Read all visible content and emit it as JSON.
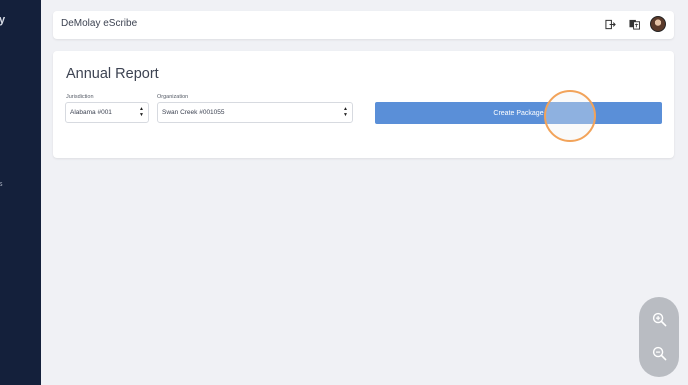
{
  "sidebar": {
    "top_glyph": "y",
    "mid_glyph": "s"
  },
  "header": {
    "app_title": "DeMolay eScribe",
    "icons": [
      "logout-icon",
      "translate-icon",
      "user-avatar"
    ]
  },
  "page": {
    "title": "Annual Report",
    "jurisdiction": {
      "label": "Jurisdiction",
      "value": "Alabama #001"
    },
    "organization": {
      "label": "Organization",
      "value": "Swan Creek #001055"
    },
    "create_button": "Create Package"
  },
  "zoom": {
    "icons": [
      "zoom-in-icon",
      "zoom-out-icon"
    ]
  },
  "colors": {
    "sidebar": "#14203b",
    "accent": "#5a8fd8",
    "click_highlight": "#f2a35a"
  }
}
